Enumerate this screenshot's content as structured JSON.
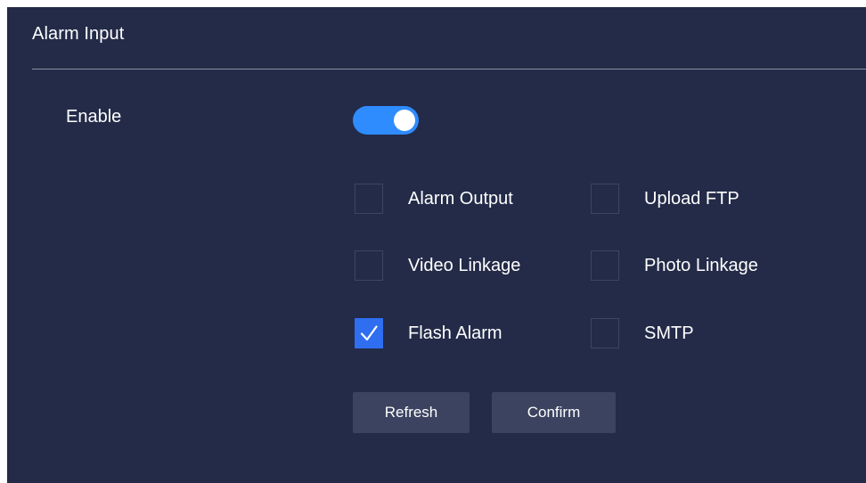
{
  "header": {
    "title": "Alarm Input"
  },
  "enable": {
    "label": "Enable",
    "state": "on"
  },
  "options": [
    {
      "label": "Alarm Output",
      "checked": false
    },
    {
      "label": "Upload FTP",
      "checked": false
    },
    {
      "label": "Video Linkage",
      "checked": false
    },
    {
      "label": "Photo Linkage",
      "checked": false
    },
    {
      "label": "Flash Alarm",
      "checked": true
    },
    {
      "label": "SMTP",
      "checked": false
    }
  ],
  "buttons": {
    "refresh_label": "Refresh",
    "confirm_label": "Confirm"
  },
  "colors": {
    "background": "#232b48",
    "accent": "#2f8cff",
    "checkbox_checked": "#2f6ef0",
    "button_bg": "#3b4360",
    "divider": "#8a90a3"
  }
}
